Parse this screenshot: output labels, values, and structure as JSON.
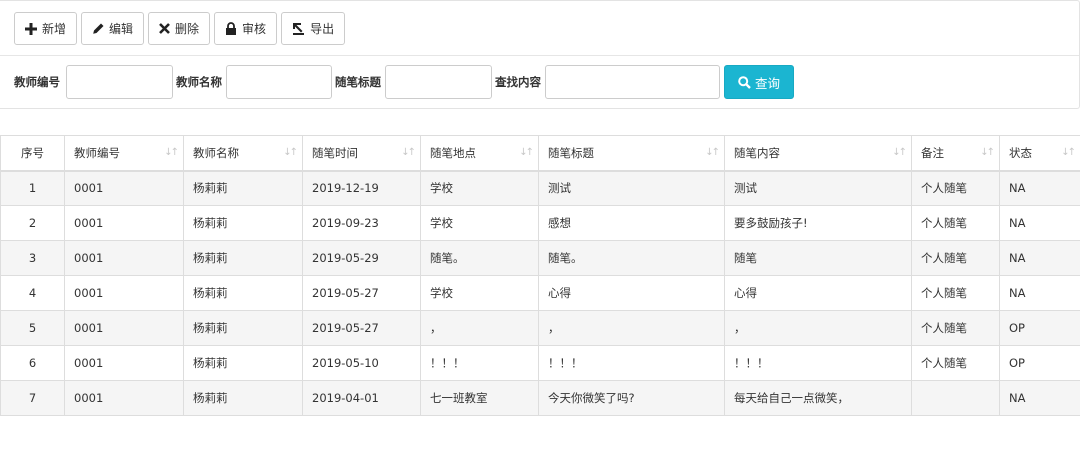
{
  "toolbar": {
    "buttons": [
      {
        "id": "add",
        "label": "新增",
        "icon": "plus-icon"
      },
      {
        "id": "edit",
        "label": "编辑",
        "icon": "pencil-icon"
      },
      {
        "id": "delete",
        "label": "删除",
        "icon": "x-icon"
      },
      {
        "id": "review",
        "label": "审核",
        "icon": "lock-icon"
      },
      {
        "id": "export",
        "label": "导出",
        "icon": "export-icon"
      }
    ]
  },
  "search": {
    "teacher_id_label": "教师编号",
    "teacher_id_value": "",
    "teacher_name_label": "教师名称",
    "teacher_name_value": "",
    "essay_title_label": "随笔标题",
    "essay_title_value": "",
    "content_label": "查找内容",
    "content_value": "",
    "query_label": "查询",
    "query_color": "#1bb5d1"
  },
  "table": {
    "columns": [
      "序号",
      "教师编号",
      "教师名称",
      "随笔时间",
      "随笔地点",
      "随笔标题",
      "随笔内容",
      "备注",
      "状态"
    ],
    "rows": [
      [
        "1",
        "0001",
        "杨莉莉",
        "2019-12-19",
        "学校",
        "测试",
        "测试",
        "个人随笔",
        "NA"
      ],
      [
        "2",
        "0001",
        "杨莉莉",
        "2019-09-23",
        "学校",
        "感想",
        "要多鼓励孩子!",
        "个人随笔",
        "NA"
      ],
      [
        "3",
        "0001",
        "杨莉莉",
        "2019-05-29",
        "随笔。",
        "随笔。",
        "随笔",
        "个人随笔",
        "NA"
      ],
      [
        "4",
        "0001",
        "杨莉莉",
        "2019-05-27",
        "学校",
        "心得",
        "心得",
        "个人随笔",
        "NA"
      ],
      [
        "5",
        "0001",
        "杨莉莉",
        "2019-05-27",
        "，",
        "，",
        "，",
        "个人随笔",
        "OP"
      ],
      [
        "6",
        "0001",
        "杨莉莉",
        "2019-05-10",
        "！！！",
        "！！！",
        "！！！",
        "个人随笔",
        "OP"
      ],
      [
        "7",
        "0001",
        "杨莉莉",
        "2019-04-01",
        "七一班教室",
        "今天你微笑了吗?",
        "每天给自己一点微笑，",
        "",
        "NA"
      ]
    ]
  }
}
